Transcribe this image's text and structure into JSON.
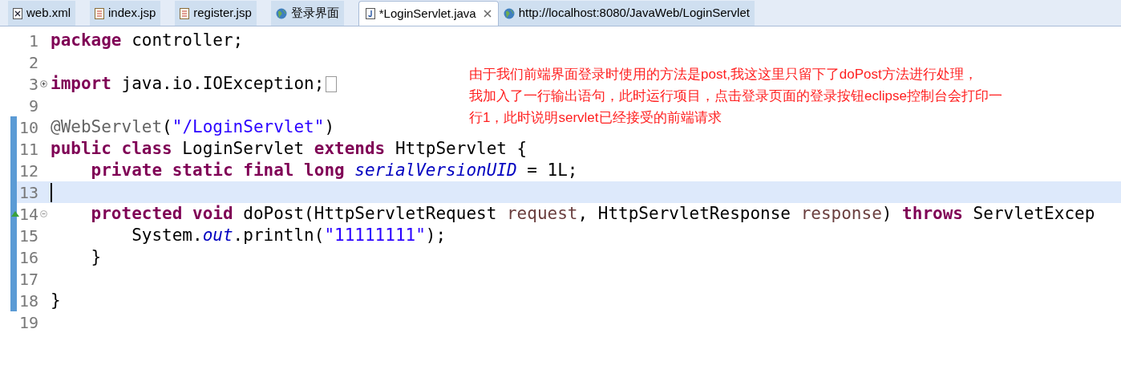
{
  "tabs": [
    {
      "label": "web.xml",
      "kind": "xml",
      "selected": false
    },
    {
      "label": "index.jsp",
      "kind": "jsp",
      "selected": false
    },
    {
      "label": "register.jsp",
      "kind": "jsp",
      "selected": false
    },
    {
      "label": "登录界面",
      "kind": "web",
      "selected": false
    },
    {
      "label": "*LoginServlet.java",
      "kind": "java",
      "selected": true
    },
    {
      "label": "http://localhost:8080/JavaWeb/LoginServlet",
      "kind": "web",
      "selected": false
    }
  ],
  "editor": {
    "lines": [
      {
        "number": "1",
        "changed": false,
        "current": false,
        "override": false,
        "tokens": [
          {
            "kind": "keyword",
            "text": "package"
          },
          {
            "kind": "plain",
            "text": " controller;"
          }
        ]
      },
      {
        "number": "2",
        "changed": false,
        "current": false,
        "override": false
      },
      {
        "number": "3",
        "changed": false,
        "current": false,
        "override": false,
        "collapsed": true,
        "tokens": [
          {
            "kind": "keyword",
            "text": "import"
          },
          {
            "kind": "plain",
            "text": " java.io.IOException;"
          }
        ]
      },
      {
        "number": "9",
        "changed": false,
        "current": false,
        "override": false
      },
      {
        "number": "10",
        "changed": true,
        "current": false,
        "override": false,
        "tokens": [
          {
            "kind": "annotation",
            "text": "@WebServlet"
          },
          {
            "kind": "plain",
            "text": "("
          },
          {
            "kind": "string",
            "text": "\"/LoginServlet\""
          },
          {
            "kind": "plain",
            "text": ")"
          }
        ]
      },
      {
        "number": "11",
        "changed": true,
        "current": false,
        "override": false,
        "tokens": [
          {
            "kind": "keyword",
            "text": "public"
          },
          {
            "kind": "keyword",
            "text": " class"
          },
          {
            "kind": "plain",
            "text": " LoginServlet "
          },
          {
            "kind": "keyword",
            "text": "extends"
          },
          {
            "kind": "plain",
            "text": " HttpServlet {"
          }
        ]
      },
      {
        "number": "12",
        "changed": true,
        "current": false,
        "override": false,
        "tokens": [
          {
            "kind": "keyword",
            "text": "    private"
          },
          {
            "kind": "keyword",
            "text": " static"
          },
          {
            "kind": "keyword",
            "text": " final"
          },
          {
            "kind": "keyword",
            "text": " long"
          },
          {
            "kind": "field",
            "text": " serialVersionUID"
          },
          {
            "kind": "plain",
            "text": " = 1L;"
          }
        ]
      },
      {
        "number": "13",
        "changed": true,
        "current": true,
        "override": false
      },
      {
        "number": "14",
        "changed": true,
        "current": false,
        "override": true,
        "collapsed": false,
        "tokens": [
          {
            "kind": "keyword",
            "text": "    protected"
          },
          {
            "kind": "keyword",
            "text": " void"
          },
          {
            "kind": "plain",
            "text": " doPost(HttpServletRequest "
          },
          {
            "kind": "param",
            "text": "request"
          },
          {
            "kind": "plain",
            "text": ", HttpServletResponse "
          },
          {
            "kind": "param",
            "text": "response"
          },
          {
            "kind": "plain",
            "text": ") "
          },
          {
            "kind": "keyword",
            "text": "throws"
          },
          {
            "kind": "plain",
            "text": " ServletExcep"
          }
        ]
      },
      {
        "number": "15",
        "changed": true,
        "current": false,
        "override": false,
        "tokens": [
          {
            "kind": "plain",
            "text": "        System."
          },
          {
            "kind": "static",
            "text": "out"
          },
          {
            "kind": "plain",
            "text": ".println("
          },
          {
            "kind": "string",
            "text": "\"11111111\""
          },
          {
            "kind": "plain",
            "text": ");"
          }
        ]
      },
      {
        "number": "16",
        "changed": true,
        "current": false,
        "override": false,
        "tokens": [
          {
            "kind": "plain",
            "text": "    }"
          }
        ]
      },
      {
        "number": "17",
        "changed": true,
        "current": false,
        "override": false
      },
      {
        "number": "18",
        "changed": true,
        "current": false,
        "override": false,
        "tokens": [
          {
            "kind": "plain",
            "text": "}"
          }
        ]
      },
      {
        "number": "19",
        "changed": false,
        "current": false,
        "override": false
      }
    ]
  },
  "note": {
    "lines": [
      "由于我们前端界面登录时使用的方法是post,我这这里只留下了doPost方法进行处理，",
      "我加入了一行输出语句，此时运行项目，点击登录页面的登录按钮eclipse控制台会打印一",
      "行1，此时说明servlet已经接受的前端请求"
    ]
  }
}
